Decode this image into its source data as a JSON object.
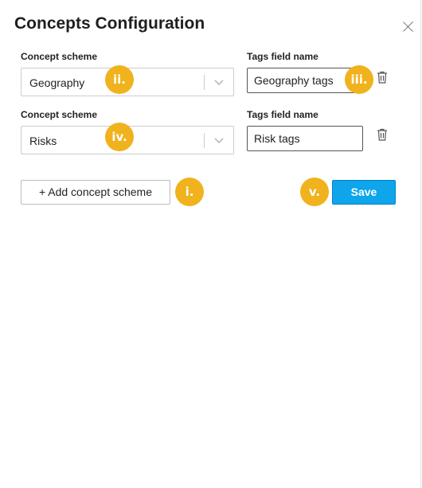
{
  "title": "Concepts Configuration",
  "rows": [
    {
      "scheme_label": "Concept scheme",
      "scheme_value": "Geography",
      "tags_label": "Tags field name",
      "tags_value": "Geography tags"
    },
    {
      "scheme_label": "Concept scheme",
      "scheme_value": "Risks",
      "tags_label": "Tags field name",
      "tags_value": "Risk tags"
    }
  ],
  "buttons": {
    "add_label": "+ Add concept scheme",
    "save_label": "Save"
  },
  "callouts": {
    "i": "i.",
    "ii": "ii.",
    "iii": "iii.",
    "iv": "iv.",
    "v": "v."
  },
  "colors": {
    "badge": "#f0b21d",
    "save": "#0ea5ea"
  },
  "icons": {
    "close": "close-icon",
    "chevron": "chevron-down-icon",
    "trash": "trash-icon"
  }
}
